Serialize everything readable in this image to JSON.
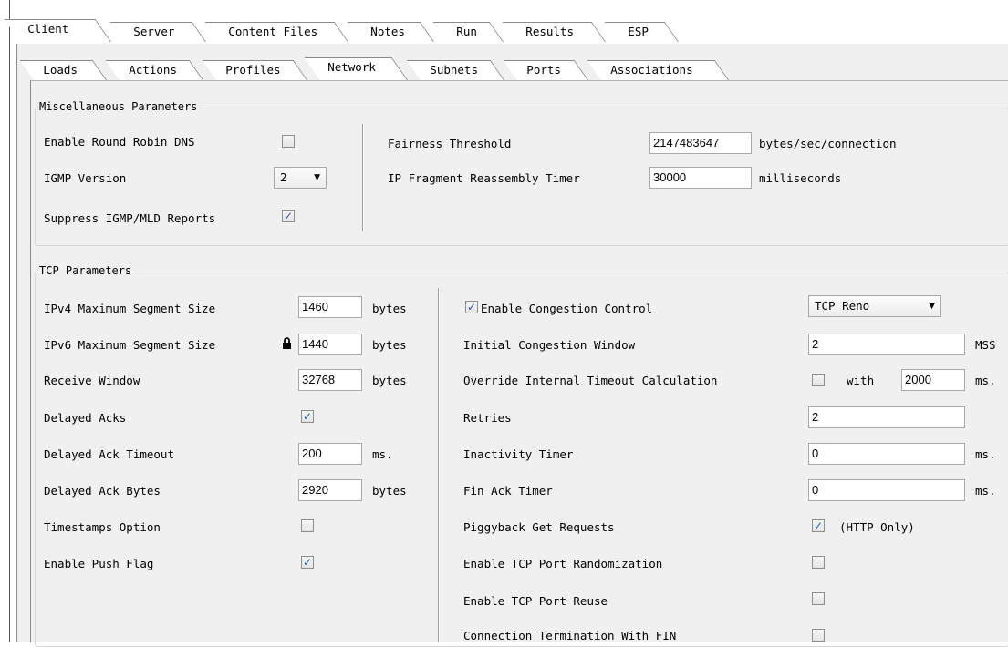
{
  "tabs_top": [
    "Client",
    "Server",
    "Content Files",
    "Notes",
    "Run",
    "Results",
    "ESP"
  ],
  "tabs_sub": [
    "Loads",
    "Actions",
    "Profiles",
    "Network",
    "Subnets",
    "Ports",
    "Associations"
  ],
  "misc": {
    "title": "Miscellaneous Parameters",
    "round_robin_label": "Enable Round Robin DNS",
    "round_robin_checked": "",
    "igmp_label": "IGMP Version",
    "igmp_value": "2",
    "suppress_label": "Suppress IGMP/MLD Reports",
    "suppress_checked": "✓",
    "fairness_label": "Fairness Threshold",
    "fairness_value": "2147483647",
    "fairness_unit": "bytes/sec/connection",
    "ipfrag_label": "IP Fragment Reassembly Timer",
    "ipfrag_value": "30000",
    "ipfrag_unit": "milliseconds"
  },
  "tcp": {
    "title": "TCP Parameters",
    "ipv4_mss_label": "IPv4 Maximum Segment Size",
    "ipv4_mss_value": "1460",
    "ipv6_mss_label": "IPv6 Maximum Segment Size",
    "ipv6_mss_value": "1440",
    "rwin_label": "Receive Window",
    "rwin_value": "32768",
    "dack_label": "Delayed Acks",
    "dack_checked": "✓",
    "dack_timeout_label": "Delayed Ack Timeout",
    "dack_timeout_value": "200",
    "dack_bytes_label": "Delayed Ack Bytes",
    "dack_bytes_value": "2920",
    "ts_label": "Timestamps Option",
    "ts_checked": "",
    "push_label": "Enable Push Flag",
    "push_checked": "✓",
    "unit_bytes": "bytes",
    "unit_ms": "ms.",
    "unit_mss": "MSS",
    "cc_checked": "✓",
    "cc_label": "Enable Congestion Control",
    "cc_algo": "TCP Reno",
    "icw_label": "Initial Congestion Window",
    "icw_value": "2",
    "override_label": "Override Internal Timeout Calculation",
    "override_checked": "",
    "with_label": "with",
    "override_value": "2000",
    "retries_label": "Retries",
    "retries_value": "2",
    "inact_label": "Inactivity Timer",
    "inact_value": "0",
    "finack_label": "Fin Ack Timer",
    "finack_value": "0",
    "piggy_label": "Piggyback Get Requests",
    "piggy_checked": "✓",
    "piggy_note": "(HTTP Only)",
    "rand_label": "Enable TCP Port Randomization",
    "rand_checked": "",
    "reuse_label": "Enable TCP Port Reuse",
    "reuse_checked": "",
    "fin_label": "Connection Termination With FIN",
    "fin_checked": ""
  }
}
